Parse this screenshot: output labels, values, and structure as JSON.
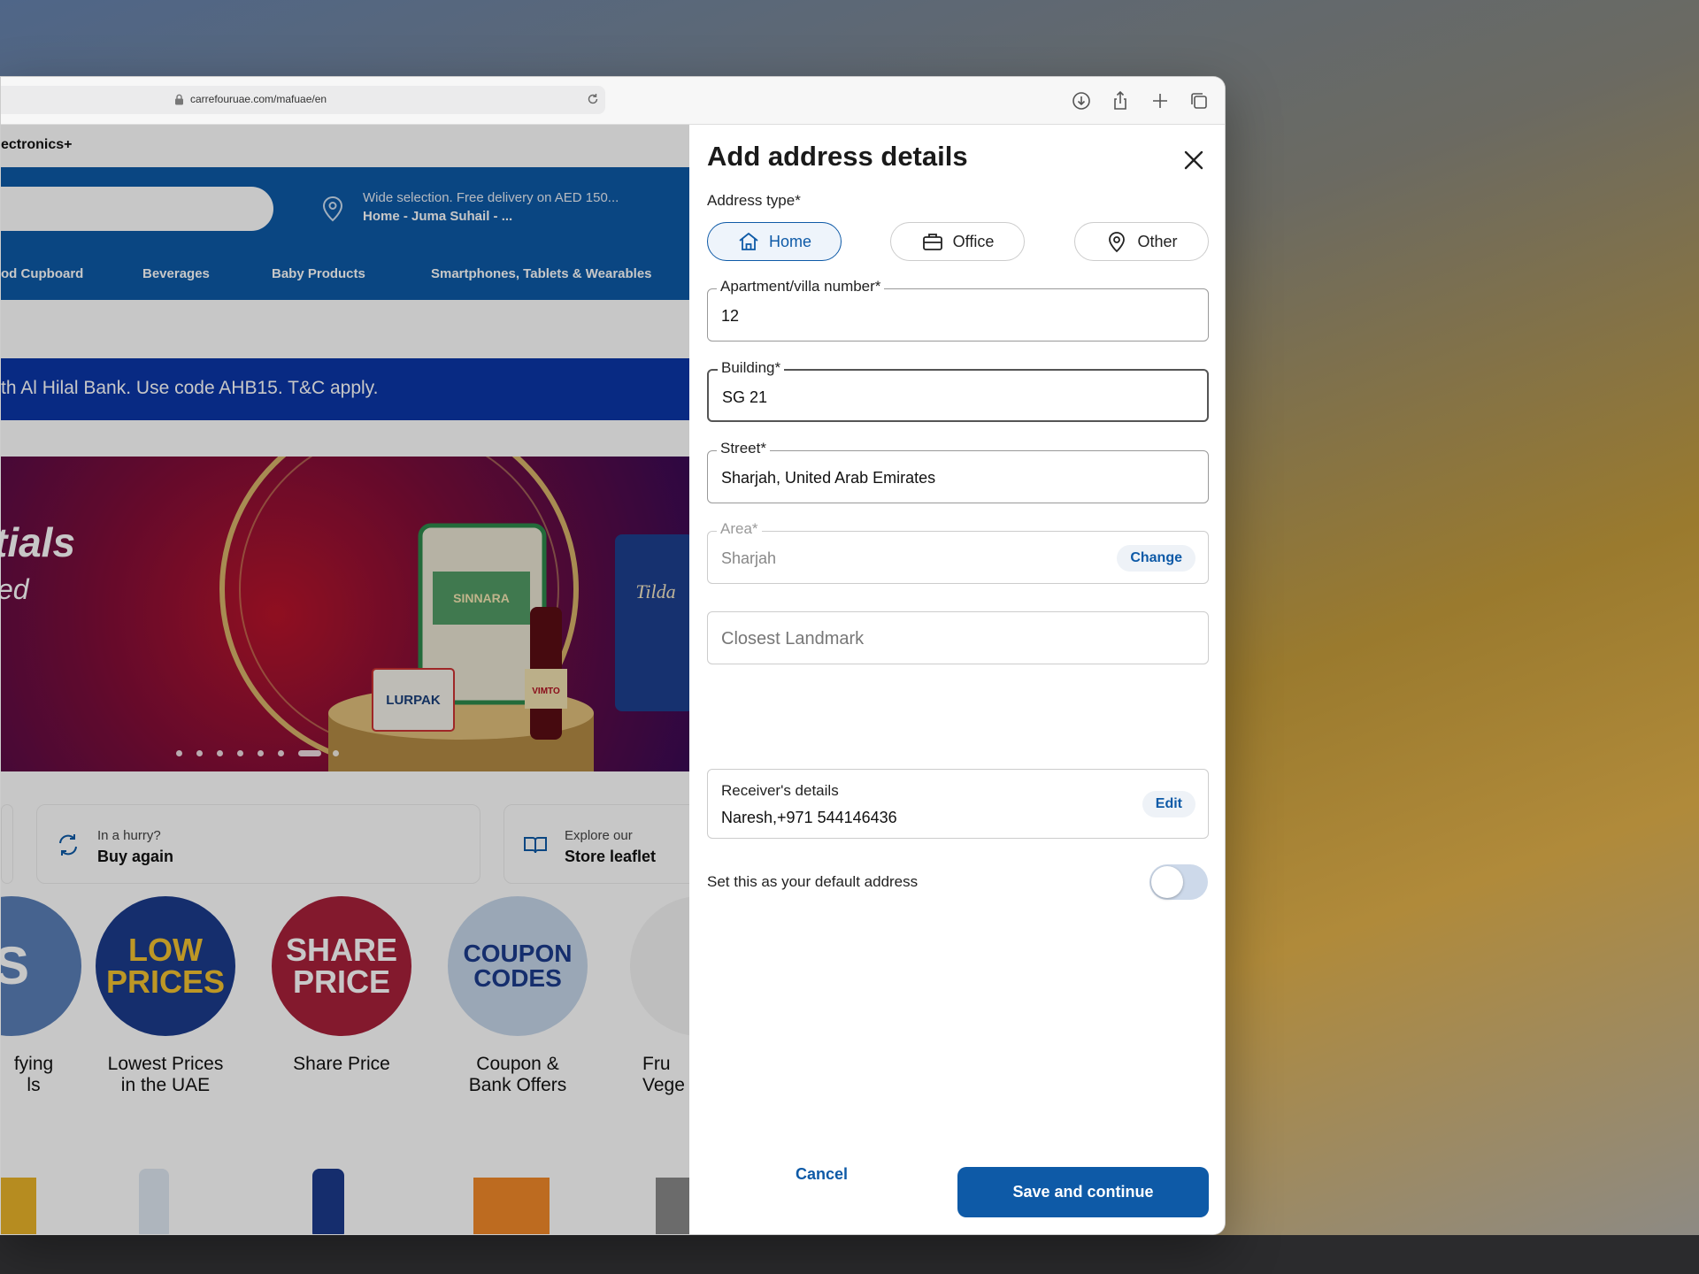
{
  "browser": {
    "url": "carrefouruae.com/mafuae/en"
  },
  "page": {
    "brand_tail": "ectronics+",
    "delivery": {
      "line1": "Wide selection. Free delivery on AED 150...",
      "line2": "Home - Juma Suhail - ..."
    },
    "categories": [
      "od Cupboard",
      "Beverages",
      "Baby Products",
      "Smartphones, Tablets & Wearables"
    ],
    "promo_text": "th Al Hilal Bank. Use code AHB15. T&C apply.",
    "hero": {
      "line1": "tials",
      "line2": "ed"
    },
    "quick_links": [
      {
        "small": "In a hurry?",
        "big": "Buy again"
      },
      {
        "small": "Explore our",
        "big": "Store leaflet"
      }
    ],
    "circles": [
      {
        "badge": "S",
        "label1": "fying",
        "label2": "ls",
        "color": "#5a7fb8"
      },
      {
        "badge": "LOW PRICES",
        "label1": "Lowest Prices",
        "label2": "in the UAE",
        "color": "#1c3c8c"
      },
      {
        "badge": "SHARE PRICE",
        "label1": "Share Price",
        "label2": "",
        "color": "#a8213a"
      },
      {
        "badge": "COUPON CODES",
        "label1": "Coupon &",
        "label2": "Bank Offers",
        "color": "#c6d6ea"
      },
      {
        "badge": "",
        "label1": "Fru",
        "label2": "Vege",
        "color": "#f4f4f4"
      }
    ],
    "hero_products": [
      "SINNARA",
      "LURPAK",
      "VIMTO",
      "Tilda"
    ]
  },
  "drawer": {
    "title": "Add address details",
    "address_type_label": "Address type*",
    "address_types": [
      {
        "label": "Home",
        "icon": "home-icon",
        "selected": true
      },
      {
        "label": "Office",
        "icon": "briefcase-icon",
        "selected": false
      },
      {
        "label": "Other",
        "icon": "location-pin-icon",
        "selected": false
      }
    ],
    "apartment": {
      "label": "Apartment/villa number*",
      "value": "12"
    },
    "building": {
      "label": "Building*",
      "value": "SG 21"
    },
    "street": {
      "label": "Street*",
      "value": "Sharjah, United Arab Emirates"
    },
    "area": {
      "label": "Area*",
      "value": "Sharjah",
      "action": "Change"
    },
    "landmark": {
      "placeholder": "Closest Landmark"
    },
    "receiver": {
      "title": "Receiver's details",
      "value": "Naresh,+971 544146436",
      "action": "Edit"
    },
    "default_address": {
      "label": "Set this as your default address",
      "on": false
    },
    "cancel_label": "Cancel",
    "save_label": "Save and continue"
  },
  "colors": {
    "accent": "#0e5aa7",
    "promo_bar": "#0b36a8"
  }
}
